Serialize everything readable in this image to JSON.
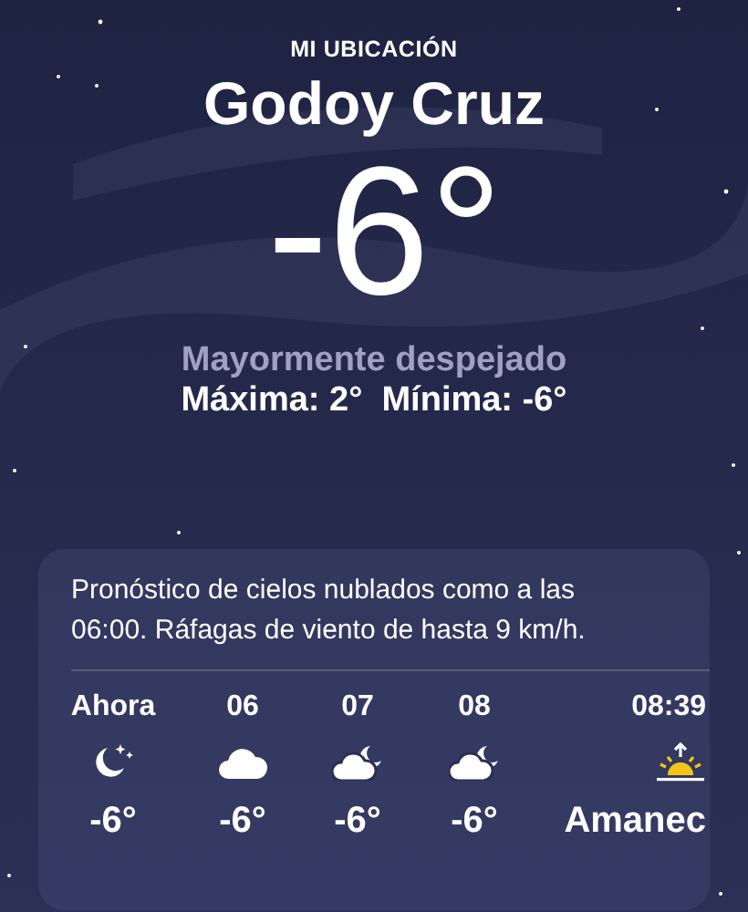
{
  "location": {
    "label": "MI UBICACIÓN",
    "city": "Godoy Cruz",
    "temperature": "-6°",
    "condition": "Mayormente despejado",
    "high_low": "Máxima: 2°  Mínima: -6°"
  },
  "forecast": {
    "summary": "Pronóstico de cielos nublados como a las 06:00. Ráfagas de viento de hasta 9 km/h.",
    "hours": [
      {
        "kind": "clear",
        "time": "Ahora",
        "value": "-6°"
      },
      {
        "kind": "cloudy",
        "time": "06",
        "value": "-6°"
      },
      {
        "kind": "partly",
        "time": "07",
        "value": "-6°"
      },
      {
        "kind": "partly",
        "time": "08",
        "value": "-6°"
      },
      {
        "kind": "sunrise",
        "time": "08:39",
        "value": "Amanec"
      }
    ]
  }
}
